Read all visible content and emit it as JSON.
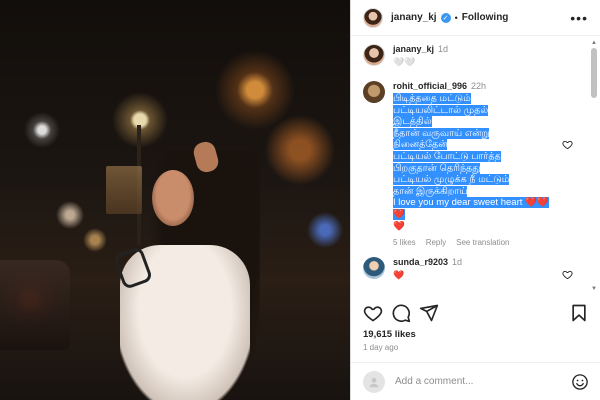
{
  "post": {
    "username": "janany_kj",
    "follow_status": "Following",
    "separator": "•",
    "more_glyph": "•••"
  },
  "caption": {
    "username": "janany_kj",
    "time": "1d",
    "text": "🤍🤍"
  },
  "comments": [
    {
      "username": "rohit_official_996",
      "time": "22h",
      "lines": [
        "பிடித்ததை மட்டும்",
        "பட்டியலிட்டால் முதல்",
        "இடத்தில்",
        "நீதான் வருவாய் என்று",
        "நினைத்தேன்",
        "பட்டியல் போட்டு பார்த்த",
        "பிறகுதான் தெரிந்தது",
        "பட்டியல் முழுக்க நீ மட்டும்",
        "தான் இருக்கிறாய்",
        "I love you my dear sweet heart ❤️❤️❤️",
        "❤️"
      ],
      "likes": "5 likes",
      "reply": "Reply",
      "translation": "See translation"
    },
    {
      "username": "sunda_r9203",
      "time": "1d",
      "text": "❤️"
    }
  ],
  "stats": {
    "likes": "19,615 likes",
    "posted": "1 day ago"
  },
  "add_comment": {
    "placeholder": "Add a comment..."
  },
  "colors": {
    "verified": "#3897f0",
    "selection": "#3390ff",
    "secondary_text": "#8e8e8e"
  }
}
